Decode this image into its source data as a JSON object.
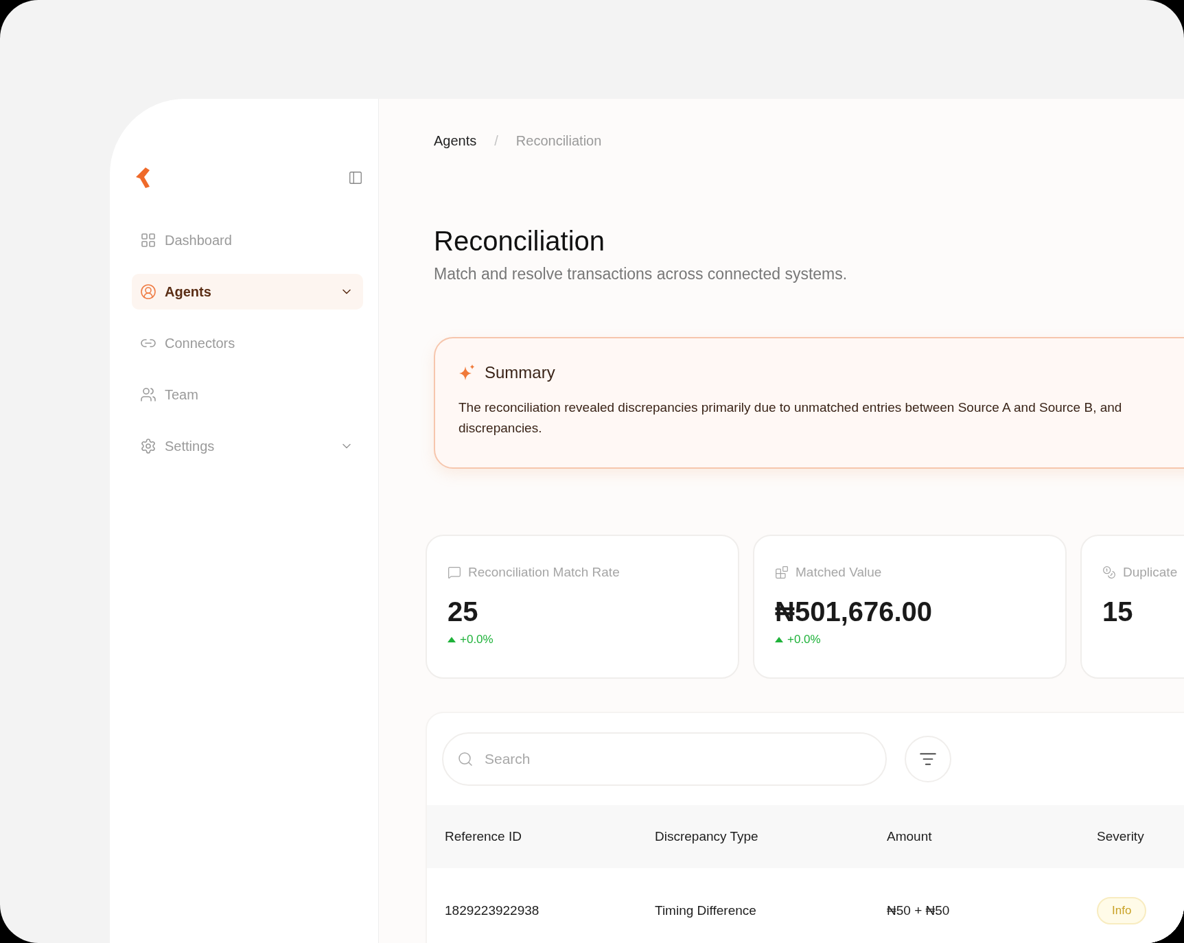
{
  "breadcrumb_separator": "/",
  "breadcrumb": [
    {
      "label": "Agents",
      "selected": false
    },
    {
      "label": "Reconciliation",
      "selected": true
    }
  ],
  "sidebar": {
    "items": [
      {
        "label": "Dashboard",
        "selected": false,
        "expandable": false
      },
      {
        "label": "Agents",
        "selected": true,
        "expandable": true
      },
      {
        "label": "Connectors",
        "selected": false,
        "expandable": false
      },
      {
        "label": "Team",
        "selected": false,
        "expandable": false
      },
      {
        "label": "Settings",
        "selected": false,
        "expandable": true
      }
    ]
  },
  "page": {
    "title": "Reconciliation",
    "subtitle": "Match and resolve transactions across connected systems."
  },
  "summary": {
    "title": "Summary",
    "text": "The reconciliation revealed discrepancies primarily due to unmatched entries between Source A and Source B, and\ndiscrepancies."
  },
  "stats": [
    {
      "label": "Reconciliation Match Rate",
      "value": "25",
      "change": "+0.0%"
    },
    {
      "label": "Matched Value",
      "value": "₦501,676.00",
      "change": "+0.0%"
    },
    {
      "label": "Duplicate",
      "value": "15"
    }
  ],
  "search": {
    "placeholder": "Search"
  },
  "table": {
    "columns": [
      "Reference ID",
      "Discrepancy Type",
      "Amount",
      "Severity"
    ],
    "rows": [
      {
        "reference_id": "1829223922938",
        "discrepancy_type": "Timing Difference",
        "amount": "₦50 + ₦50",
        "severity": "Info"
      }
    ]
  }
}
